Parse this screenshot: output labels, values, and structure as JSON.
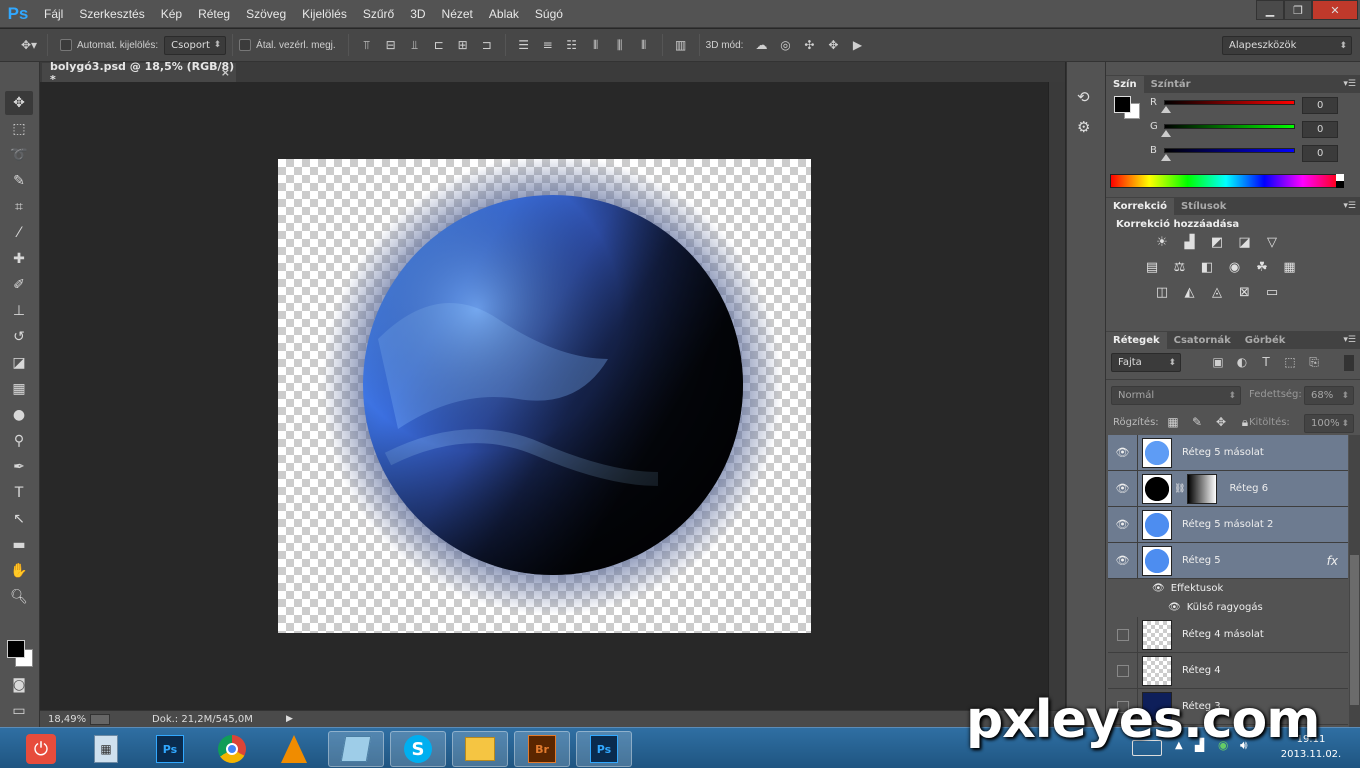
{
  "app": {
    "logo": "Ps"
  },
  "menu": [
    "Fájl",
    "Szerkesztés",
    "Kép",
    "Réteg",
    "Szöveg",
    "Kijelölés",
    "Szűrő",
    "3D",
    "Nézet",
    "Ablak",
    "Súgó"
  ],
  "options": {
    "auto_select_label": "Automat. kijelölés:",
    "auto_select_value": "Csoport",
    "transform_label": "Átal. vezérl. megj.",
    "mode_3d_label": "3D mód:",
    "workspace": "Alapeszközök"
  },
  "document": {
    "tab_title": "bolygó3.psd @ 18,5% (RGB/8) *",
    "close_glyph": "×"
  },
  "status": {
    "zoom": "18,49%",
    "doc_info": "Dok.: 21,2M/545,0M"
  },
  "color_panel": {
    "tabs": [
      "Szín",
      "Színtár"
    ],
    "channels": [
      {
        "label": "R",
        "value": "0"
      },
      {
        "label": "G",
        "value": "0"
      },
      {
        "label": "B",
        "value": "0"
      }
    ]
  },
  "adjust_panel": {
    "tabs": [
      "Korrekció",
      "Stílusok"
    ],
    "heading": "Korrekció hozzáadása"
  },
  "layers_panel": {
    "tabs": [
      "Rétegek",
      "Csatornák",
      "Görbék"
    ],
    "filter_label": "Fajta",
    "blend_mode": "Normál",
    "opacity_label": "Fedettség:",
    "opacity_value": "68%",
    "lock_label": "Rögzítés:",
    "fill_label": "Kitöltés:",
    "fill_value": "100%",
    "layers": [
      {
        "name": "Réteg 5 másolat",
        "visible": true,
        "selected": true
      },
      {
        "name": "Réteg 6",
        "visible": true,
        "selected": true
      },
      {
        "name": "Réteg 5 másolat 2",
        "visible": true,
        "selected": true
      },
      {
        "name": "Réteg 5",
        "visible": true,
        "selected": true,
        "fx": "fx"
      },
      {
        "name": "Réteg 4 másolat",
        "visible": false,
        "selected": false
      },
      {
        "name": "Réteg 4",
        "visible": false,
        "selected": false
      },
      {
        "name": "Réteg 3",
        "visible": false,
        "selected": false
      }
    ],
    "effects_label": "Effektusok",
    "effect_item": "Külső ragyogás"
  },
  "taskbar": {
    "time": "19:11",
    "date": "2013.11.02.",
    "apps": [
      "Ps",
      "Br",
      "Ps"
    ]
  },
  "watermark": "pxleyes.com"
}
